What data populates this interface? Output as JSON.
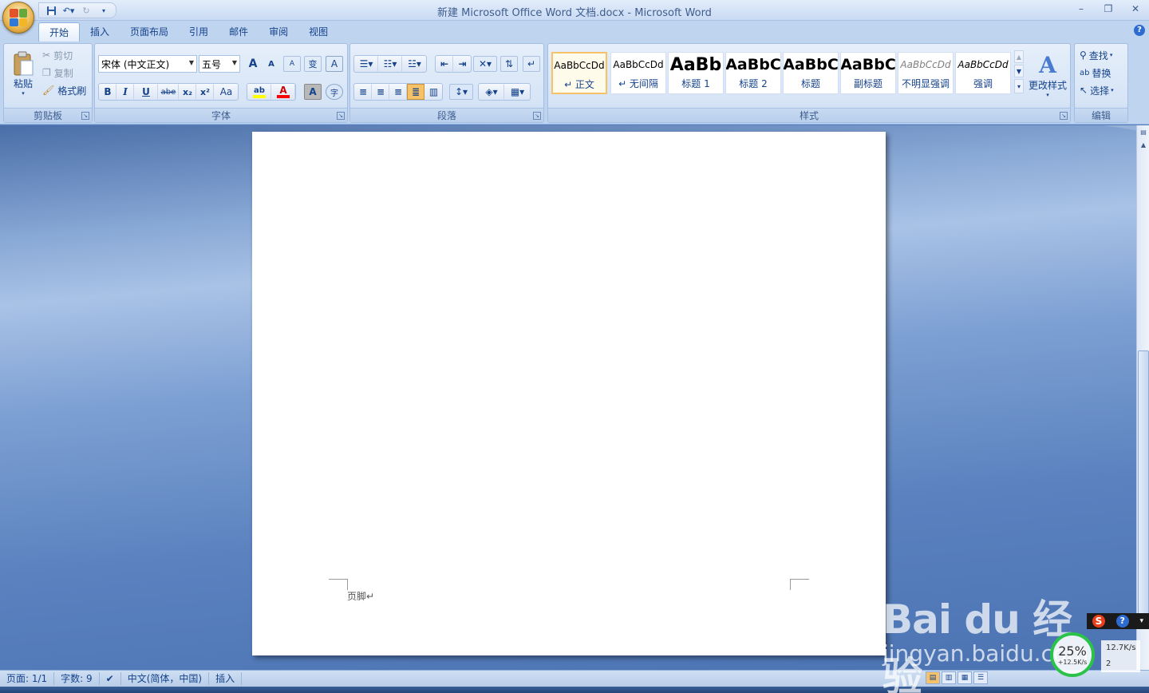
{
  "window": {
    "title": "新建 Microsoft Office Word 文档.docx - Microsoft Word"
  },
  "qat": {
    "save_icon": "save-icon",
    "undo_icon": "undo-icon",
    "redo_icon": "redo-icon"
  },
  "tabs": [
    {
      "label": "开始",
      "active": true
    },
    {
      "label": "插入"
    },
    {
      "label": "页面布局"
    },
    {
      "label": "引用"
    },
    {
      "label": "邮件"
    },
    {
      "label": "审阅"
    },
    {
      "label": "视图"
    }
  ],
  "clipboard": {
    "group_label": "剪贴板",
    "paste": "粘贴",
    "cut": "剪切",
    "copy": "复制",
    "format_painter": "格式刷"
  },
  "font": {
    "group_label": "字体",
    "font_name": "宋体 (中文正文)",
    "font_size": "五号",
    "bold": "B",
    "italic": "I",
    "underline": "U",
    "strike": "abe",
    "subscript": "x₂",
    "superscript": "x²",
    "change_case": "Aa",
    "grow": "A",
    "shrink": "A",
    "clear": "A",
    "phonetic": "变",
    "border": "A",
    "highlight": "ab",
    "color": "A",
    "shade": "A",
    "enclose": "字"
  },
  "paragraph": {
    "group_label": "段落"
  },
  "styles": {
    "group_label": "样式",
    "items": [
      {
        "sample": "AaBbCcDd",
        "name": "↵ 正文"
      },
      {
        "sample": "AaBbCcDd",
        "name": "↵ 无间隔"
      },
      {
        "sample": "AaBb",
        "name": "标题 1"
      },
      {
        "sample": "AaBbC",
        "name": "标题 2"
      },
      {
        "sample": "AaBbC",
        "name": "标题"
      },
      {
        "sample": "AaBbC",
        "name": "副标题"
      },
      {
        "sample": "AaBbCcDd",
        "name": "不明显强调"
      },
      {
        "sample": "AaBbCcDd",
        "name": "强调"
      }
    ],
    "change_styles": "更改样式"
  },
  "editing": {
    "group_label": "编辑",
    "find": "查找",
    "replace": "替换",
    "select": "选择"
  },
  "document": {
    "footer_label": "页脚↵"
  },
  "status": {
    "page": "页面: 1/1",
    "words": "字数: 9",
    "language": "中文(简体，中国)",
    "mode": "插入"
  },
  "watermark": {
    "main": "Bai du 经验",
    "sub": "jingyan.baidu.com"
  },
  "ime": {
    "logo": "S",
    "help": "?"
  },
  "network": {
    "percent": "25%",
    "speed_circle": "+12.5K/s",
    "upload": "12.7K/s",
    "count": "2"
  },
  "colors": {
    "accent": "#15428b",
    "highlight": "#f5c26a"
  }
}
